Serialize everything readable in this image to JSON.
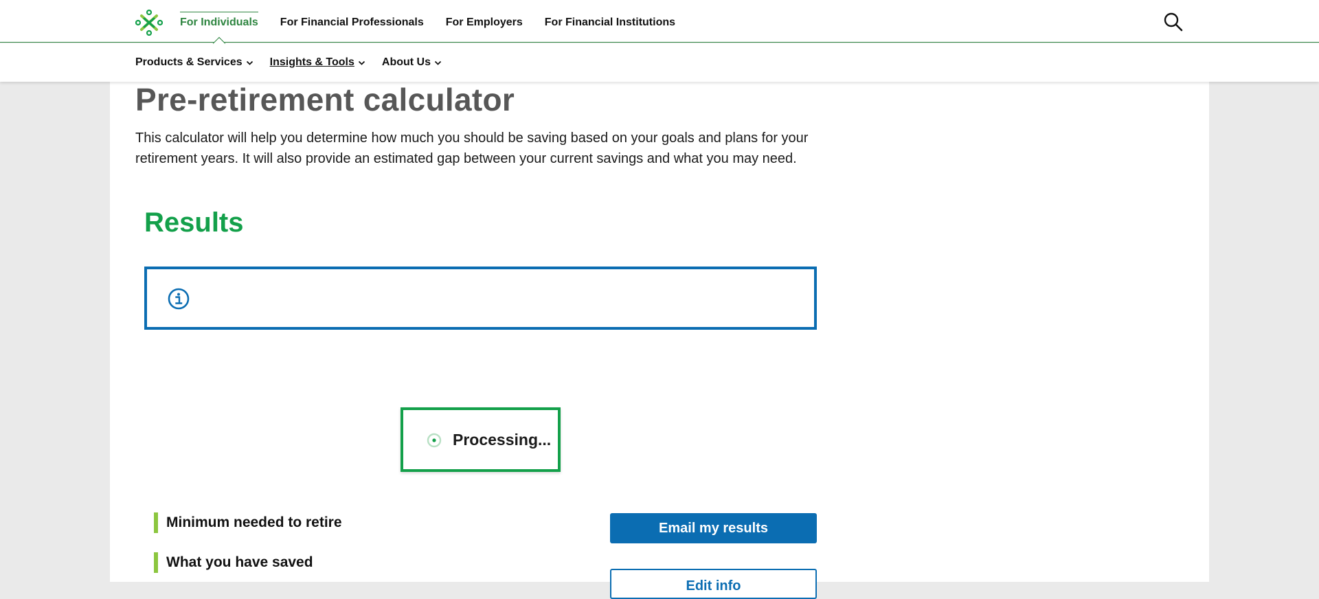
{
  "header": {
    "logo_icon": "brand-logo-icon",
    "nav": [
      {
        "label": "For Individuals",
        "active": true
      },
      {
        "label": "For Financial Professionals",
        "active": false
      },
      {
        "label": "For Employers",
        "active": false
      },
      {
        "label": "For Financial Institutions",
        "active": false
      }
    ],
    "search_icon": "search-icon"
  },
  "subnav": [
    {
      "label": "Products & Services"
    },
    {
      "label": "Insights & Tools"
    },
    {
      "label": "About Us"
    }
  ],
  "main": {
    "title": "Pre-retirement calculator",
    "intro": "This calculator will help you determine how much you should be saving based on your goals and plans for your retirement years. It will also provide an estimated gap between your current savings and what you may need.",
    "results_title": "Results",
    "info_icon": "info-icon",
    "processing_text": "Processing...",
    "metrics": [
      {
        "label": "Minimum needed to retire"
      },
      {
        "label": "What you have saved"
      }
    ],
    "email_button": "Email my results",
    "edit_button": "Edit info"
  },
  "colors": {
    "brand_green": "#13a04a",
    "nav_green": "#2e8540",
    "primary_blue": "#0b6db2",
    "accent_lime": "#8cc63f",
    "title_gray": "#575757"
  }
}
